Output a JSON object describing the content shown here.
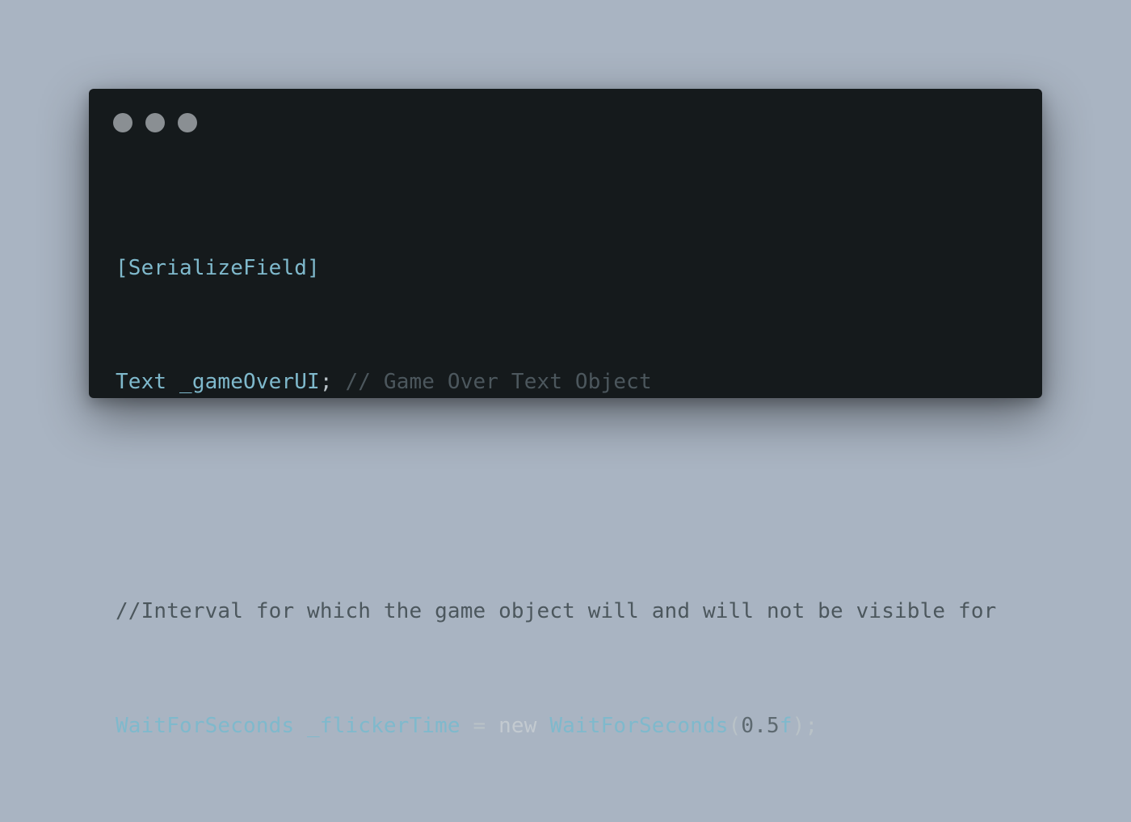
{
  "colors": {
    "background": "#a9b4c2",
    "window": "#151a1c",
    "dot": "#8a8f93",
    "type": "#7fb9cc",
    "punct": "#b9c2c7",
    "comment": "#4c575d",
    "number": "#5d6970",
    "keyword": "#c3cad0"
  },
  "window_controls": [
    {
      "name": "close-dot"
    },
    {
      "name": "minimize-dot"
    },
    {
      "name": "maximize-dot"
    }
  ],
  "code": {
    "line1": {
      "attribute": "[SerializeField]"
    },
    "line2": {
      "type": "Text",
      "var": " _gameOverUI",
      "semi": ";",
      "comment": " // Game Over Text Object"
    },
    "line3": {},
    "line4": {
      "comment": "//Interval for which the game object will and will not be visible for"
    },
    "line5": {
      "type": "WaitForSeconds",
      "var": " _flickerTime",
      "assign": " = ",
      "keyword": "new",
      "ctor": " WaitForSeconds",
      "open": "(",
      "number": "0.5",
      "suffix": "f",
      "close": ");"
    }
  }
}
